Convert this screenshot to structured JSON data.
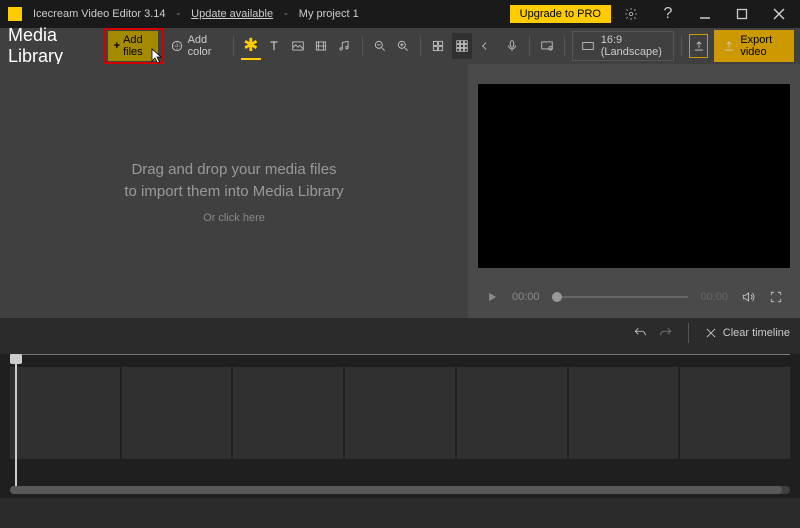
{
  "titlebar": {
    "app": "Icecream Video Editor 3.14",
    "update": "Update available",
    "project": "My project 1",
    "upgrade": "Upgrade to PRO"
  },
  "toolbar": {
    "media_library": "Media Library",
    "add_files": "Add files",
    "add_color": "Add color",
    "aspect": "16:9 (Landscape)",
    "export": "Export video"
  },
  "library": {
    "line1": "Drag and drop your media files",
    "line2": "to import them into Media Library",
    "sub": "Or click here"
  },
  "player": {
    "current": "00:00",
    "total": "00:00"
  },
  "tlbar": {
    "clear": "Clear timeline"
  }
}
